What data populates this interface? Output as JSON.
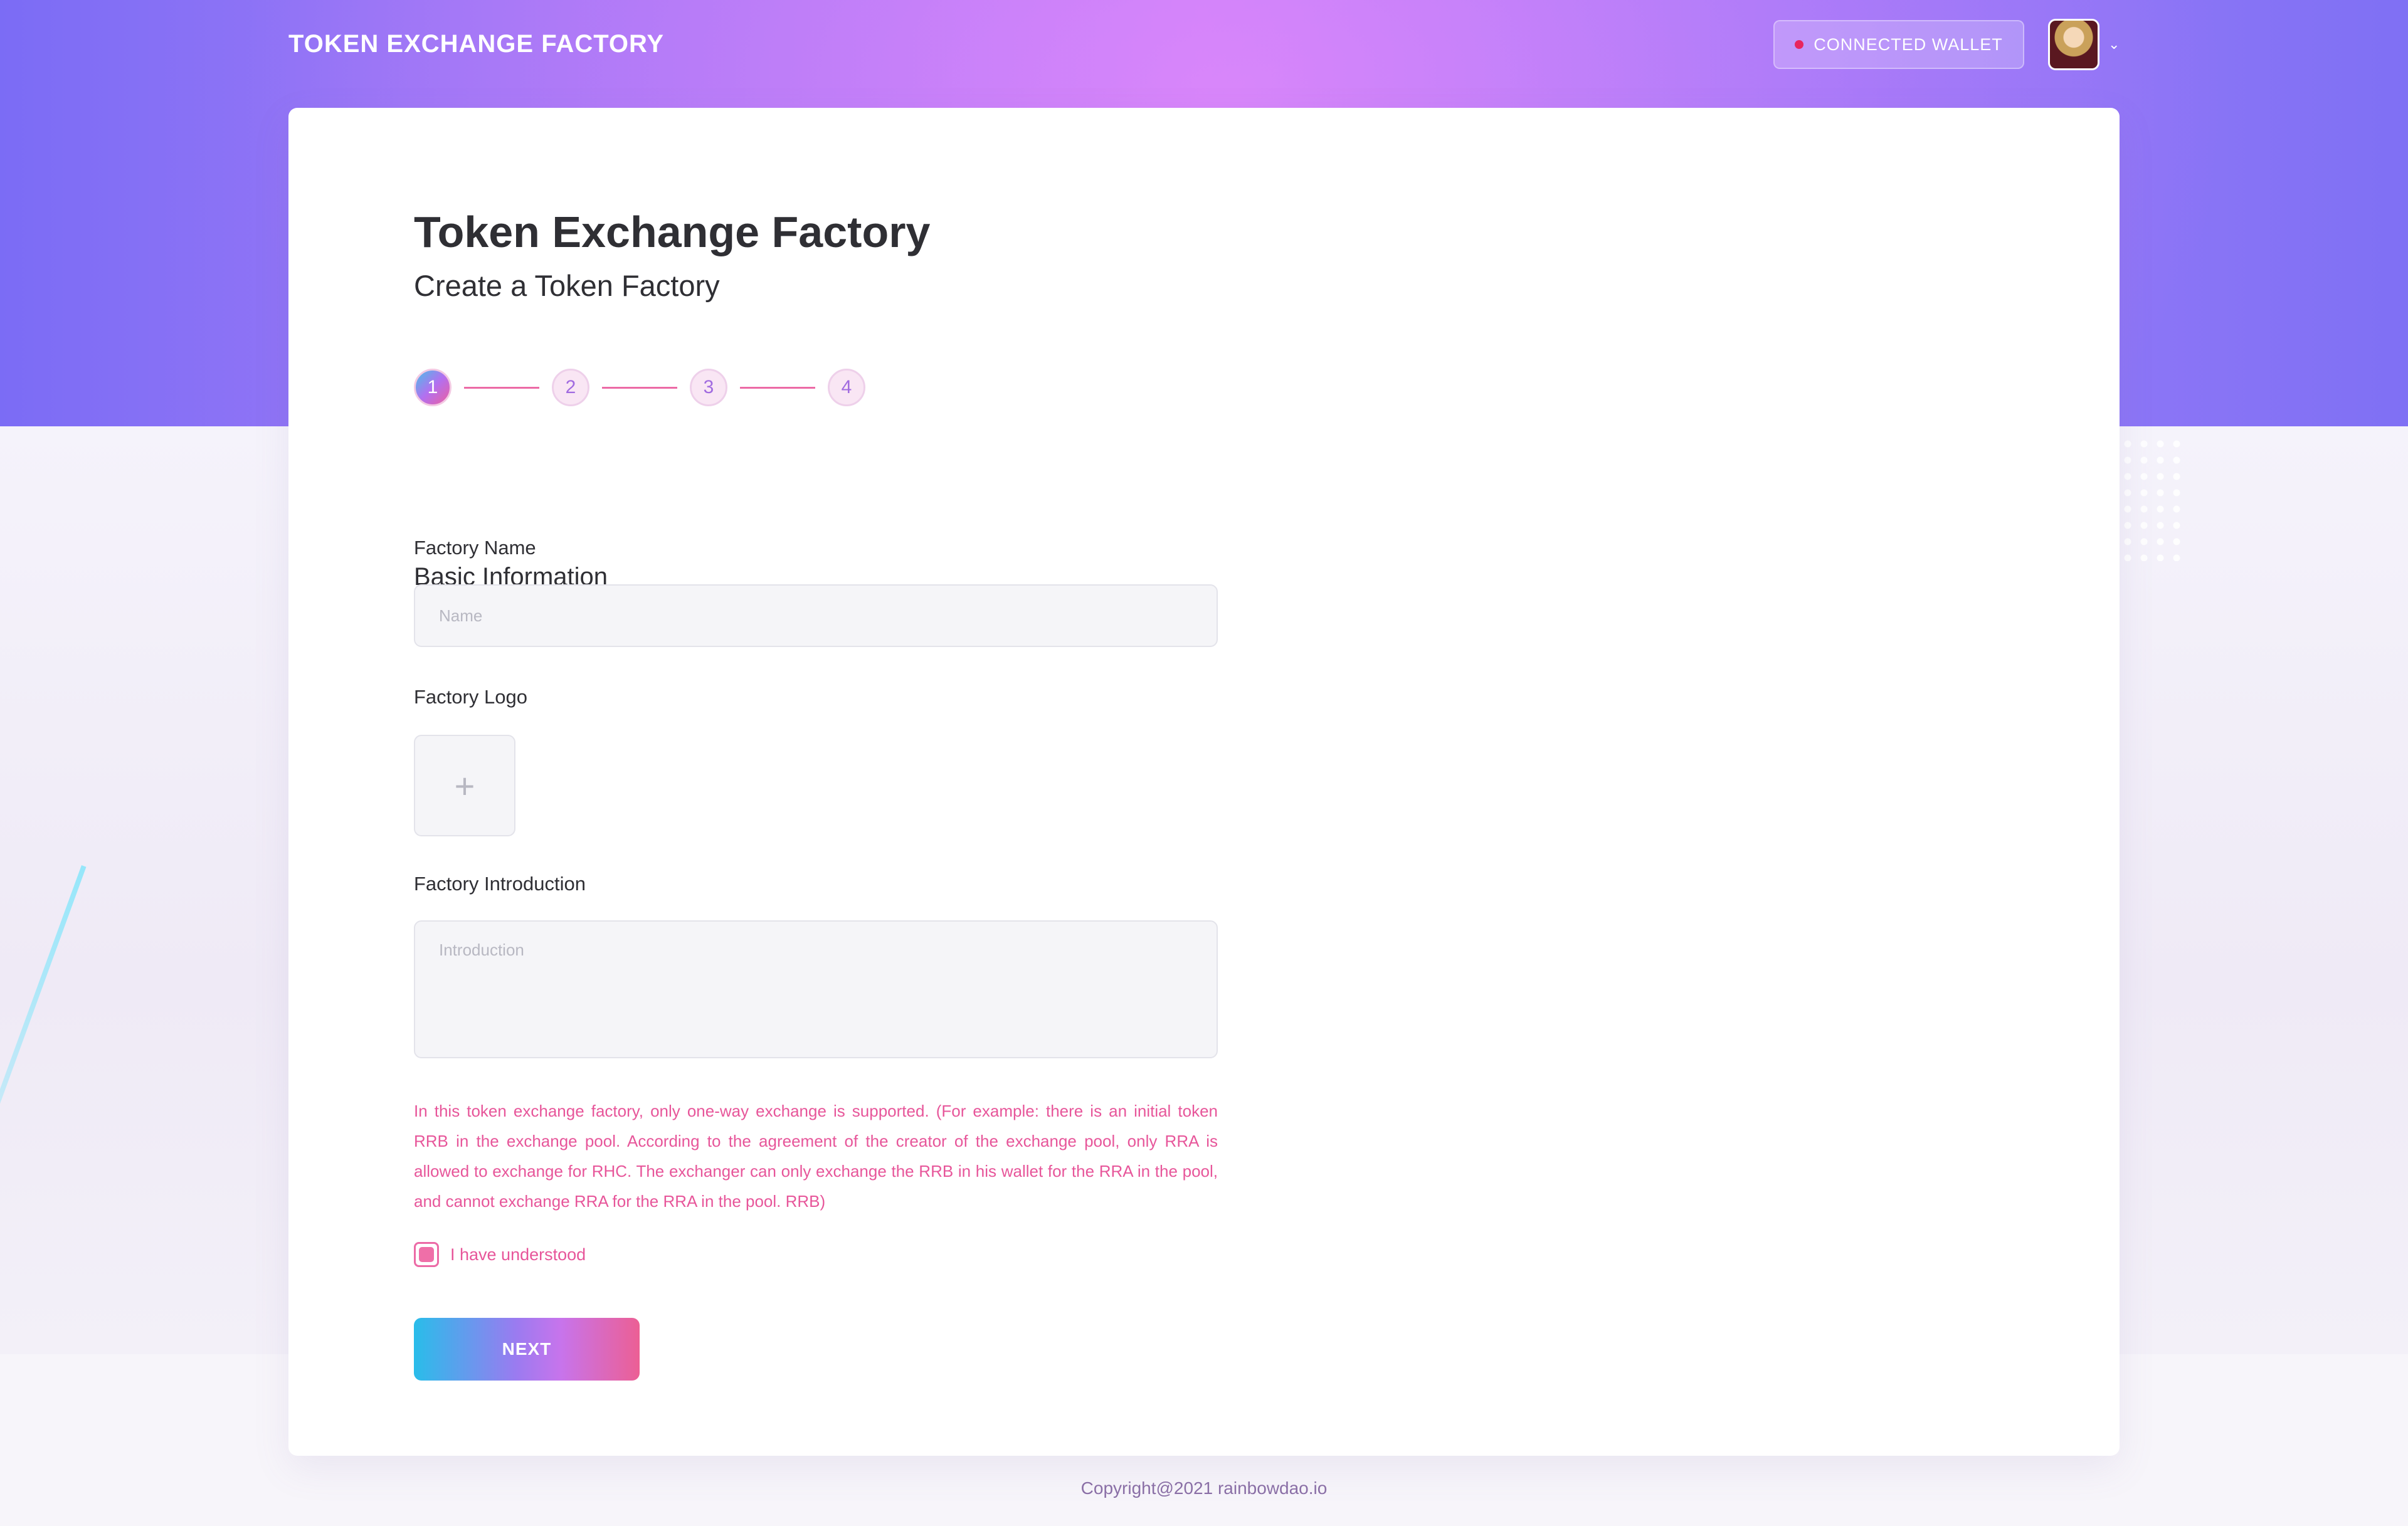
{
  "header": {
    "brand": "TOKEN EXCHANGE FACTORY",
    "wallet_button_label": "CONNECTED  WALLET",
    "wallet_status_color": "#e8265e"
  },
  "page": {
    "title": "Token Exchange Factory",
    "subtitle": "Create a Token Factory"
  },
  "stepper": {
    "steps": [
      "1",
      "2",
      "3",
      "4"
    ],
    "active_step": 1
  },
  "form": {
    "section_title": "Basic Information",
    "name_label": "Factory Name",
    "name_placeholder": "Name",
    "name_value": "",
    "logo_label": "Factory Logo",
    "logo_add_glyph": "+",
    "intro_label": "Factory Introduction",
    "intro_placeholder": "Introduction",
    "intro_value": "",
    "notice": "In this token exchange factory, only one-way exchange is supported. (For example: there is an initial token RRB in the exchange pool. According to the agreement of the creator of the exchange pool, only RRA is allowed to exchange for RHC. The exchanger can only exchange the RRB in his wallet for the RRA in the pool, and cannot exchange RRA for the RRA in the pool. RRB)",
    "agree_label": "I have understood",
    "agree_checked": true,
    "next_button": "NEXT"
  },
  "footer": {
    "copyright": "Copyright@2021 rainbowdao.io"
  },
  "colors": {
    "accent_pink": "#e7569a",
    "brand_purple": "#a57cf6"
  }
}
